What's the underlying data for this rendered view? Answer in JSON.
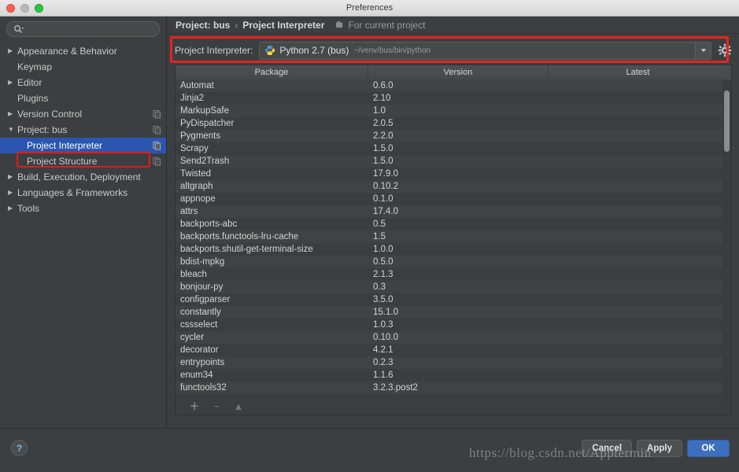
{
  "window": {
    "title": "Preferences",
    "traffic_lights": [
      "close-button",
      "minimize-button",
      "zoom-button"
    ]
  },
  "sidebar": {
    "search": {
      "value": "",
      "placeholder": ""
    },
    "items": [
      {
        "label": "Appearance & Behavior",
        "arrow": "▶",
        "child": false,
        "selected": false,
        "has_icon": false
      },
      {
        "label": "Keymap",
        "arrow": "",
        "child": false,
        "selected": false,
        "has_icon": false
      },
      {
        "label": "Editor",
        "arrow": "▶",
        "child": false,
        "selected": false,
        "has_icon": false
      },
      {
        "label": "Plugins",
        "arrow": "",
        "child": false,
        "selected": false,
        "has_icon": false
      },
      {
        "label": "Version Control",
        "arrow": "▶",
        "child": false,
        "selected": false,
        "has_icon": true
      },
      {
        "label": "Project: bus",
        "arrow": "▼",
        "child": false,
        "selected": false,
        "has_icon": true
      },
      {
        "label": "Project Interpreter",
        "arrow": "",
        "child": true,
        "selected": true,
        "has_icon": true
      },
      {
        "label": "Project Structure",
        "arrow": "",
        "child": true,
        "selected": false,
        "has_icon": true
      },
      {
        "label": "Build, Execution, Deployment",
        "arrow": "▶",
        "child": false,
        "selected": false,
        "has_icon": false
      },
      {
        "label": "Languages & Frameworks",
        "arrow": "▶",
        "child": false,
        "selected": false,
        "has_icon": false
      },
      {
        "label": "Tools",
        "arrow": "▶",
        "child": false,
        "selected": false,
        "has_icon": false
      }
    ]
  },
  "breadcrumb": {
    "parent": "Project: bus",
    "separator": "›",
    "current": "Project Interpreter",
    "scope": "For current project"
  },
  "interpreter": {
    "label": "Project Interpreter:",
    "value": "Python 2.7 (bus)",
    "path": "~/venv/bus/bin/python",
    "dropdown_arrow": "▼",
    "settings_icon": "gear-icon",
    "highlight_color": "#e8231e"
  },
  "packages": {
    "columns": [
      "Package",
      "Version",
      "Latest"
    ],
    "rows": [
      [
        "Automat",
        "0.6.0",
        ""
      ],
      [
        "Jinja2",
        "2.10",
        ""
      ],
      [
        "MarkupSafe",
        "1.0",
        ""
      ],
      [
        "PyDispatcher",
        "2.0.5",
        ""
      ],
      [
        "Pygments",
        "2.2.0",
        ""
      ],
      [
        "Scrapy",
        "1.5.0",
        ""
      ],
      [
        "Send2Trash",
        "1.5.0",
        ""
      ],
      [
        "Twisted",
        "17.9.0",
        ""
      ],
      [
        "altgraph",
        "0.10.2",
        ""
      ],
      [
        "appnope",
        "0.1.0",
        ""
      ],
      [
        "attrs",
        "17.4.0",
        ""
      ],
      [
        "backports-abc",
        "0.5",
        ""
      ],
      [
        "backports.functools-lru-cache",
        "1.5",
        ""
      ],
      [
        "backports.shutil-get-terminal-size",
        "1.0.0",
        ""
      ],
      [
        "bdist-mpkg",
        "0.5.0",
        ""
      ],
      [
        "bleach",
        "2.1.3",
        ""
      ],
      [
        "bonjour-py",
        "0.3",
        ""
      ],
      [
        "configparser",
        "3.5.0",
        ""
      ],
      [
        "constantly",
        "15.1.0",
        ""
      ],
      [
        "cssselect",
        "1.0.3",
        ""
      ],
      [
        "cycler",
        "0.10.0",
        ""
      ],
      [
        "decorator",
        "4.2.1",
        ""
      ],
      [
        "entrypoints",
        "0.2.3",
        ""
      ],
      [
        "enum34",
        "1.1.6",
        ""
      ],
      [
        "functools32",
        "3.2.3.post2",
        ""
      ],
      [
        "",
        "",
        ""
      ]
    ],
    "toolbar": [
      {
        "name": "add-package-button",
        "glyph": "＋",
        "enabled": true
      },
      {
        "name": "remove-package-button",
        "glyph": "−",
        "enabled": false
      },
      {
        "name": "upgrade-package-button",
        "glyph": "▲",
        "enabled": false
      }
    ]
  },
  "footer": {
    "help_label": "?",
    "buttons": [
      {
        "name": "cancel-button",
        "label": "Cancel",
        "primary": false
      },
      {
        "name": "apply-button",
        "label": "Apply",
        "primary": false
      },
      {
        "name": "ok-button",
        "label": "OK",
        "primary": true
      }
    ]
  },
  "watermark": {
    "text": "https://blog.csdn.net/Apptermin"
  }
}
